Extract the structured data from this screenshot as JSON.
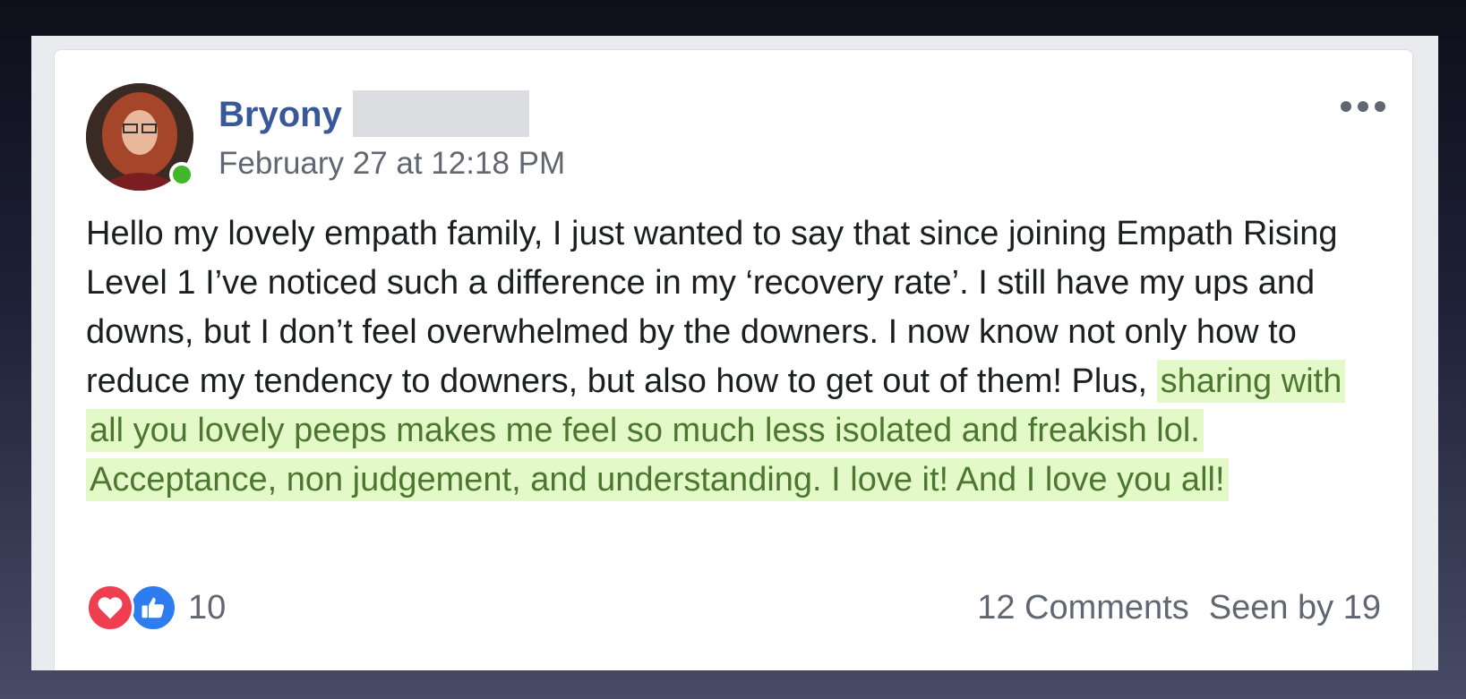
{
  "post": {
    "author": {
      "first_name": "Bryony",
      "online": true
    },
    "timestamp": "February 27 at 12:18 PM",
    "body_plain": "Hello my lovely empath family, I just wanted to say that since joining Empath Rising Level 1 I’ve noticed such a difference in my ‘recovery rate’. I still have my ups and downs, but I don’t feel overwhelmed by the downers. I now know not only how to reduce my tendency to downers, but also how to get out of them! Plus, ",
    "body_highlighted": "sharing with all you lovely peeps makes me feel so much less isolated and freakish lol. Acceptance, non judgement, and understanding. I love it! And I love you all!",
    "reactions": {
      "types": [
        "love-icon",
        "like-icon"
      ],
      "count": "10"
    },
    "comments": "12 Comments",
    "seen_by": "Seen by 19"
  },
  "colors": {
    "author_link": "#385898",
    "secondary_text": "#616770",
    "highlight_bg": "#e3fac8",
    "highlight_text": "#4d7731",
    "online": "#42b72a",
    "love": "#ee3e50",
    "like": "#2d7cf0"
  }
}
